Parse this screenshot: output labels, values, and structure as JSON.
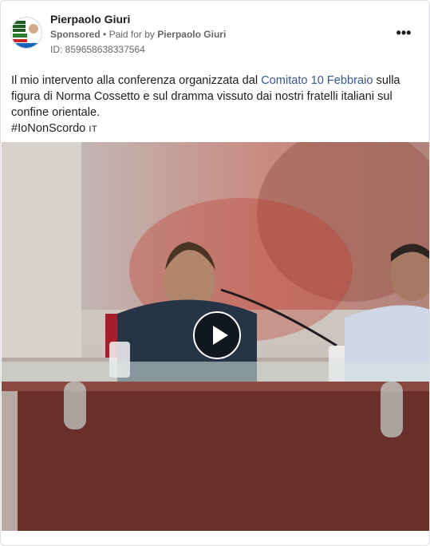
{
  "post": {
    "author_name": "Pierpaolo Giuri",
    "sponsored_label": "Sponsored",
    "separator": "•",
    "paid_for_prefix": "Paid for by",
    "paid_for_name": "Pierpaolo Giuri",
    "ad_id": "ID: 859658638337564",
    "more_label": "•••",
    "text": {
      "part1": "Il mio intervento alla conferenza organizzata dal ",
      "link": "Comitato 10 Febbraio",
      "part2": " sulla figura di Norma Cossetto e sul dramma vissuto dai nostri fratelli italiani sul confine orientale.",
      "hashtag": "#IoNonScordo",
      "language_tag": "IT"
    },
    "avatar_icon": "campaign-logo-icon",
    "video": {
      "play_icon": "play-icon"
    }
  },
  "colors": {
    "link": "#385898",
    "secondary_text": "#65676b",
    "border": "#dddfe2"
  }
}
